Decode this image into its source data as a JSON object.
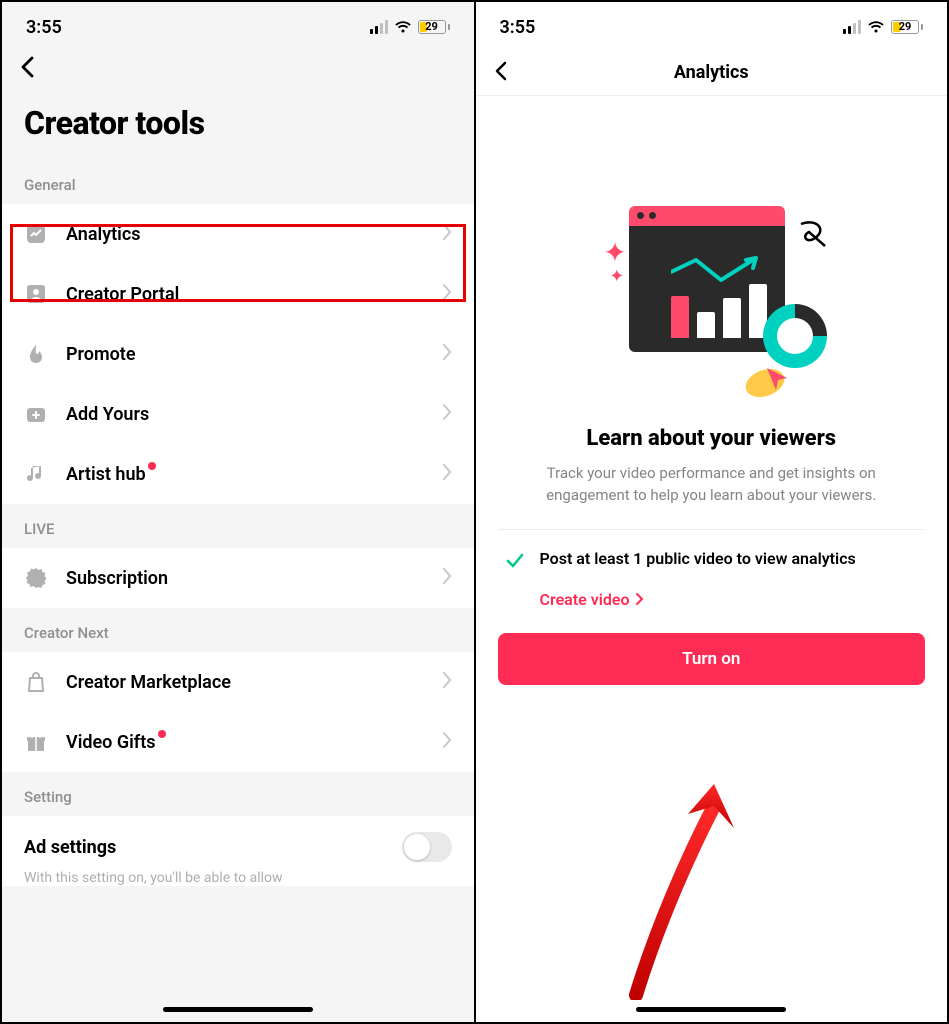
{
  "status": {
    "time": "3:55",
    "battery": "29"
  },
  "left": {
    "title": "Creator tools",
    "sections": [
      {
        "header": "General",
        "items": [
          {
            "icon": "analytics",
            "label": "Analytics"
          },
          {
            "icon": "portal",
            "label": "Creator Portal"
          },
          {
            "icon": "promote",
            "label": "Promote"
          },
          {
            "icon": "addyours",
            "label": "Add Yours"
          },
          {
            "icon": "music",
            "label": "Artist hub",
            "badge": true
          }
        ]
      },
      {
        "header": "LIVE",
        "items": [
          {
            "icon": "subscription",
            "label": "Subscription"
          }
        ]
      },
      {
        "header": "Creator Next",
        "items": [
          {
            "icon": "marketplace",
            "label": "Creator Marketplace"
          },
          {
            "icon": "gifts",
            "label": "Video Gifts",
            "badge": true
          }
        ]
      },
      {
        "header": "Setting",
        "items": []
      }
    ],
    "setting": {
      "label": "Ad settings",
      "desc": "With this setting on, you'll be able to allow"
    }
  },
  "right": {
    "title": "Analytics",
    "headline": "Learn about your viewers",
    "subtext": "Track your video performance and get insights on engagement to help you learn about your viewers.",
    "requirement": "Post at least 1 public video to view analytics",
    "link": "Create video",
    "button": "Turn on"
  }
}
